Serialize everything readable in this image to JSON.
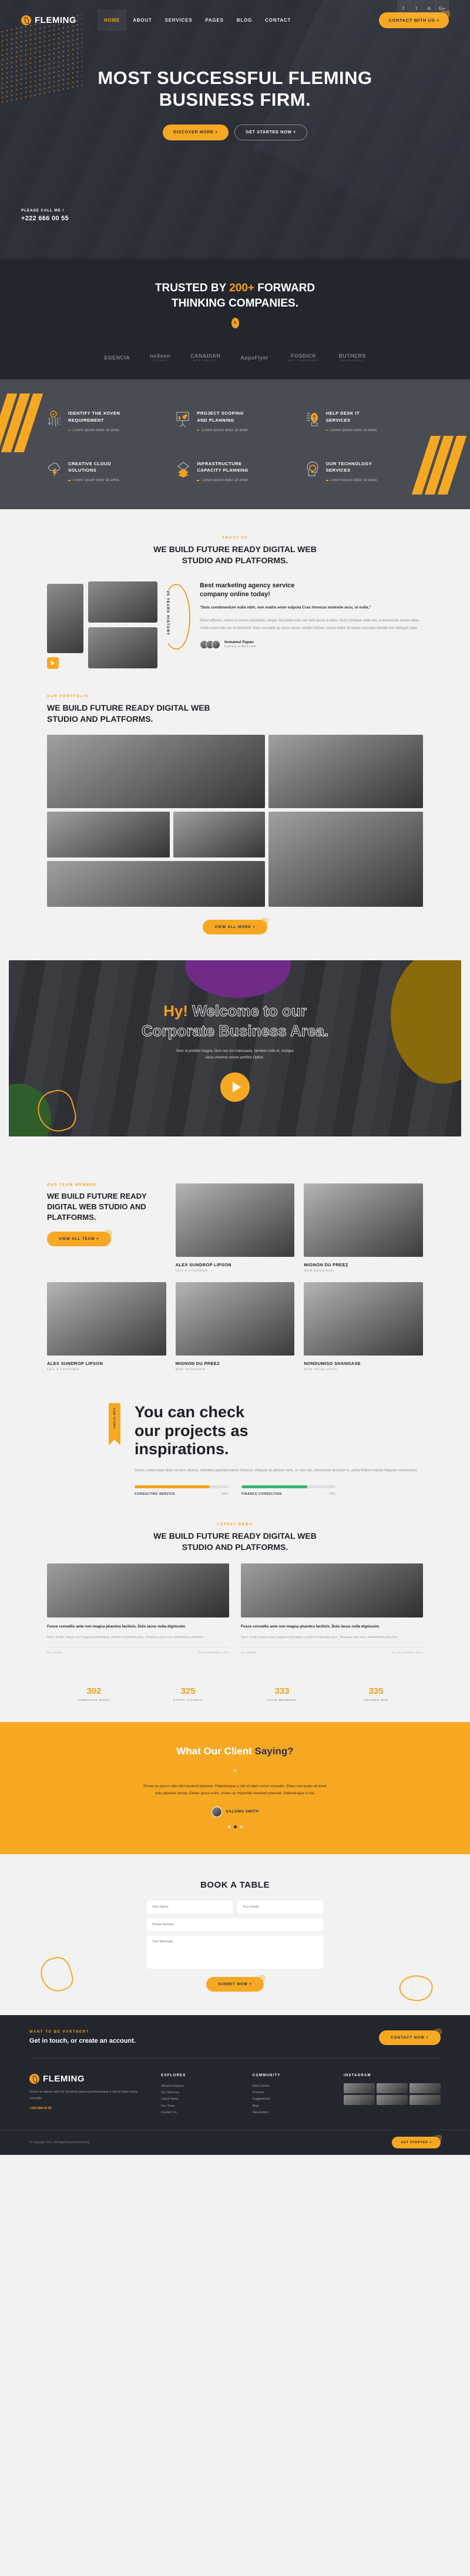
{
  "brand": {
    "name": "FLEMING",
    "accent": "#f2a01e",
    "dark": "#24262e"
  },
  "social": [
    {
      "name": "facebook-icon",
      "glyph": "f"
    },
    {
      "name": "twitter-icon",
      "glyph": "t"
    },
    {
      "name": "linkedin-icon",
      "glyph": "in"
    },
    {
      "name": "google-plus-icon",
      "glyph": "G+"
    }
  ],
  "nav": {
    "items": [
      {
        "label": "HOME",
        "active": true
      },
      {
        "label": "ABOUT",
        "active": false
      },
      {
        "label": "SERVICES",
        "active": false
      },
      {
        "label": "PAGES",
        "active": false
      },
      {
        "label": "BLOG",
        "active": false
      },
      {
        "label": "CONTACT",
        "active": false
      }
    ],
    "cta": "CONTACT WITH US  +"
  },
  "hero": {
    "title_line1": "MOST SUCCESSFUL FLEMING",
    "title_line2": "BUSINESS FIRM.",
    "btn_primary": "DISCOVER MORE  +",
    "btn_secondary": "GET STARTED NOW  +",
    "call_label": "PLEASE CALL ME !",
    "call_number": "+222 666 00 55"
  },
  "trusted": {
    "line1_pre": "TRUSTED BY ",
    "line1_hl": "200+",
    "line1_post": " FORWARD",
    "line2": "THINKING COMPANIES.",
    "badge": "X",
    "brands": [
      {
        "name": "EGENCIA",
        "sub": ""
      },
      {
        "name": "neXeon",
        "sub": "TECHNO"
      },
      {
        "name": "CANADIAN",
        "sub": "WEB HOSTING"
      },
      {
        "name": "AppsFlyer",
        "sub": ""
      },
      {
        "name": "FOSDICK",
        "sub": "EST. CORPORATE"
      },
      {
        "name": "BUTHERS",
        "sub": "RESTAURANT"
      }
    ]
  },
  "services": {
    "items": [
      {
        "icon": "pencil-check-icon",
        "title_l1": "IDENTIFY THE XOVEN",
        "title_l2": "REQUIREMENT",
        "desc": "Lorem ipsum dolor sit amet."
      },
      {
        "icon": "presentation-chart-icon",
        "title_l1": "PROJECT SCOPING",
        "title_l2": "AND PLANNING",
        "desc": "Lorem ipsum dolor sit amet."
      },
      {
        "icon": "headset-support-icon",
        "title_l1": "HELP DESK IT",
        "title_l2": "SERVICES",
        "desc": "Lorem ipsum dolor sit amet."
      },
      {
        "icon": "cloud-bolt-icon",
        "title_l1": "CREATIVE CLOUD",
        "title_l2": "SOLUTIONS",
        "desc": "Lorem ipsum dolor sit amet."
      },
      {
        "icon": "layers-stack-icon",
        "title_l1": "INFRASTRUCTURE",
        "title_l2": "CAPACITY PLANNING",
        "desc": "Lorem ipsum dolor sit amet."
      },
      {
        "icon": "head-bulb-icon",
        "title_l1": "OUR TECHNOLOGY",
        "title_l2": "SERVICES",
        "desc": "Lorem ipsum dolor sit amet."
      }
    ]
  },
  "about": {
    "eyebrow": "ABOUT US",
    "title_l1": "WE BUILD FUTURE READY DIGITAL WEB",
    "title_l2": "STUDIO AND PLATFORMS.",
    "years_badge": "25 YEARS HISTORY",
    "heading_l1": "Best marketing agency service",
    "heading_l2": "company online today!",
    "quote": "\"Duis condimentum nulla nibh, non mattis enim vulputa Cras rhoncus molestie arcu, ut nulla.\"",
    "body": "Etiam efficitur, metus in cursus imperdiet, neque nisl porta erat, nec felis lacus a tellus. Nunc tristique nulla nisi, a viverra dui auctor vitae. mollis commodo leo in hendrerit. Nam convallis ac lacus luctus vestibu Donec cursus tellus id neque convallis blandit unc tristique nulla.",
    "author_name": "Immamul Papan",
    "author_role": "CUFKO DIRECTOR"
  },
  "portfolio": {
    "eyebrow": "OUR PORTFOLIO",
    "title_l1": "WE BUILD FUTURE READY DIGITAL WEB",
    "title_l2": "STUDIO AND PLATFORMS.",
    "button": "VIEW ALL MORE  +"
  },
  "welcome": {
    "hy": "Hy!",
    "title_rest": " Welcome to our",
    "title_l2": "Corporate Business Area.",
    "desc_l1": "Nam ut porttitor magna. Duis non dui malesuada, hendreri nulla et, tristique",
    "desc_l2": "lacus vivamus ornare porttitor Option.",
    "play": "play-button"
  },
  "team": {
    "eyebrow": "OUR TEAM MEMBER",
    "title_l1": "WE BUILD FUTURE READY",
    "title_l2": "DIGITAL WEB STUDIO AND",
    "title_l3": "PLATFORMS.",
    "button": "VIEW ALL TEAM  +",
    "members": [
      {
        "name": "ALEX SUNDROP LIPSON",
        "role": "CEO & FOUNDER"
      },
      {
        "name": "MIGNON DU PREEZ",
        "role": "WEB DESIGNER"
      },
      {
        "name": "ALEX SUNDROP LIPSON",
        "role": "CEO & FOUNDER"
      },
      {
        "name": "MIGNON DU PREEZ",
        "role": "WEB DESIGNER"
      },
      {
        "name": "NONDUMISO SHANGASE",
        "role": "WEB DEVELOPER"
      }
    ]
  },
  "story": {
    "ribbon": "OUR STORY",
    "title_l1": "You can check",
    "title_l2": "our projects as",
    "title_l3": "inspirations.",
    "body": "Donec scelerisque dolor id nunc dictum, interdum gravida mauris rhoncus. Aliquam at ultrices nunc. In sem leo, fermentum at lorem in, porta finibus mauris Aliquam consectetur.",
    "skills": [
      {
        "label": "CONSULTING SERVICE",
        "value": "/ 80%",
        "pct": 80,
        "color": "#f2a01e"
      },
      {
        "label": "FINANCE CONSULTING",
        "value": "/ 70%",
        "pct": 70,
        "color": "#3bb273"
      }
    ]
  },
  "news": {
    "eyebrow": "LATEST NEWS",
    "title_l1": "WE BUILD FUTURE READY DIGITAL WEB",
    "title_l2": "STUDIO AND PLATFORMS.",
    "posts": [
      {
        "title": "Fusce convallis ante non magna pharetra facilisis. Duis lacus nulla dignissim.",
        "text": "Nunc mollis neque erat magna scelerisque, pretium imperdiet arcu. Vivamus quis nunc elementum pharetra.",
        "meta_left": "BY ADMIN",
        "meta_right": "25 DECEMBER 2021"
      },
      {
        "title": "Fusce convallis ante non magna pharetra facilisis. Duis lacus nulla dignissim.",
        "text": "Nunc mollis neque erat magna scelerisque, pretium imperdiet arcu. Vivamus quis nunc elementum pharetra.",
        "meta_left": "BY ADMIN",
        "meta_right": "25 DECEMBER 2021"
      }
    ]
  },
  "counters": [
    {
      "num": "302",
      "label": "COMPLETE WORK"
    },
    {
      "num": "325",
      "label": "HAPPY CLIENTS"
    },
    {
      "num": "333",
      "label": "TEAM MEMBERS"
    },
    {
      "num": "335",
      "label": "AWARDS WIN"
    }
  ],
  "testimonial": {
    "title_pre": "What Our Client ",
    "title_dark": "Saying?",
    "quote_mark": "“",
    "text": "Donec eu ipsum odio bid hendrerit placerat. Pellentesque a nisl sit diam luctus convallis. Etiam non quam sit amet odio placerta lacinia. Donec purus enim, ornare ac imperdiet hendrerit placerat. Pellentesque a nisl.",
    "author": "SALOMA SMITH",
    "dots": 3,
    "active_dot": 1
  },
  "book": {
    "title": "BOOK A TABLE",
    "fields": {
      "name": "Your Name",
      "email": "Your Email",
      "phone": "Phone Number",
      "message": "Your Message"
    },
    "button": "SUBMIT NOW  +"
  },
  "footer": {
    "cta_eyebrow": "WANT TO BE PARTNER?",
    "cta_title": "Get in touch, or create an account.",
    "cta_button": "CONTACT NOW  +",
    "about": {
      "desc": "Donec eu ipsum odio bid hendrerit placerat pellentesque a nisl sit diam luctus convallis.",
      "phone": "+222 666 00 55"
    },
    "columns": [
      {
        "title": "EXPLORES",
        "links": [
          "About Company",
          "Our Services",
          "Latest News",
          "Our Team",
          "Contact Us"
        ]
      },
      {
        "title": "COMMUNITY",
        "links": [
          "Help Center",
          "Partners",
          "Suggestions",
          "Blog",
          "Newsletters"
        ]
      }
    ],
    "instagram_title": "INSTAGRAM",
    "copyright": "© Copyright 2021,  All Right Reserved Fleming",
    "bottom_button": "GET STARTED  +"
  }
}
